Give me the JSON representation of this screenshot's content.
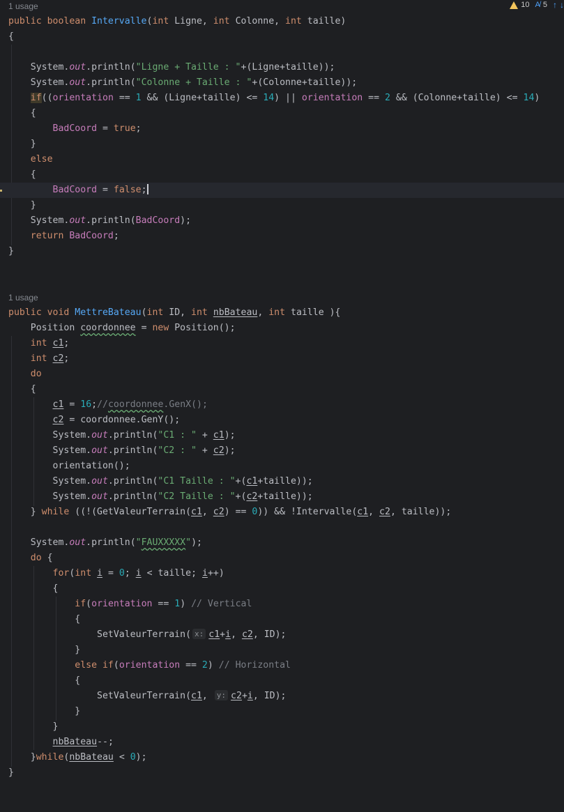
{
  "inspections": {
    "warnings": "10",
    "typos": "5",
    "up_arrow": "↑",
    "down_arrow": "↓"
  },
  "usages": {
    "first": "1 usage",
    "second": "1 usage"
  },
  "icons": [
    "warning-icon",
    "typo-icon",
    "arrow-up-icon",
    "arrow-down-icon"
  ],
  "colors": {
    "background": "#1e1f22",
    "keyword": "#cf8e6d",
    "function": "#56a8f5",
    "string": "#6aab73",
    "number": "#2aacb8",
    "field": "#c77dbb",
    "comment": "#7a7e85",
    "text": "#bcbec4"
  },
  "code": [
    "public boolean Intervalle(int Ligne, int Colonne, int taille)",
    "{",
    "",
    "    System.out.println(\"Ligne + Taille : \"+(Ligne+taille));",
    "    System.out.println(\"Colonne + Taille : \"+(Colonne+taille));",
    "    if((orientation == 1 && (Ligne+taille) <= 14) || orientation == 2 && (Colonne+taille) <= 14)",
    "    {",
    "        BadCoord = true;",
    "    }",
    "    else",
    "    {",
    "        BadCoord = false;",
    "    }",
    "    System.out.println(BadCoord);",
    "    return BadCoord;",
    "}",
    "",
    "",
    "public void MettreBateau(int ID, int nbBateau, int taille ){",
    "    Position coordonnee = new Position();",
    "    int c1;",
    "    int c2;",
    "    do",
    "    {",
    "        c1 = 16;//coordonnee.GenX();",
    "        c2 = coordonnee.GenY();",
    "        System.out.println(\"C1 : \" + c1);",
    "        System.out.println(\"C2 : \" + c2);",
    "        orientation();",
    "        System.out.println(\"C1 Taille : \"+(c1+taille));",
    "        System.out.println(\"C2 Taille : \"+(c2+taille));",
    "    } while ((!(GetValeurTerrain(c1, c2) == 0)) && !Intervalle(c1, c2, taille));",
    "",
    "    System.out.println(\"FAUXXXXX\");",
    "    do {",
    "        for(int i = 0; i < taille; i++)",
    "        {",
    "            if(orientation == 1) // Vertical",
    "            {",
    "                SetValeurTerrain( x: c1+i, c2, ID);",
    "            }",
    "            else if(orientation == 2) // Horizontal",
    "            {",
    "                SetValeurTerrain(c1,  y: c2+i, ID);",
    "            }",
    "        }",
    "        nbBateau--;",
    "    }while(nbBateau < 0);",
    "}"
  ]
}
